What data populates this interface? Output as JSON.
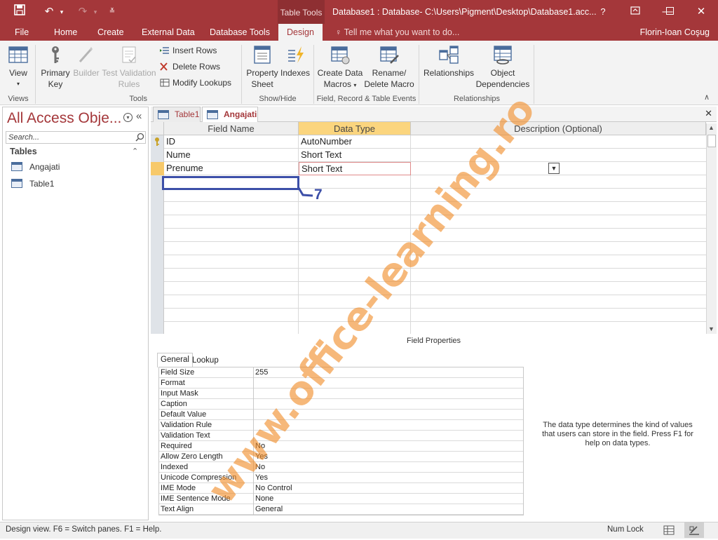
{
  "title_bar": {
    "context_tab": "Table Tools",
    "window_title": "Database1 : Database- C:\\Users\\Pigment\\Desktop\\Database1.acc...",
    "help": "?"
  },
  "menu": {
    "tabs": [
      "File",
      "Home",
      "Create",
      "External Data",
      "Database Tools",
      "Design"
    ],
    "active_tab": "Design",
    "tell_me": "Tell me what you want to do...",
    "user": "Florin-Ioan Coşug"
  },
  "ribbon": {
    "view": "View",
    "primary_key": [
      "Primary",
      "Key"
    ],
    "builder": "Builder",
    "test_validation": [
      "Test Validation",
      "Rules"
    ],
    "insert_rows": "Insert Rows",
    "delete_rows": "Delete Rows",
    "modify_lookups": "Modify Lookups",
    "property_sheet": [
      "Property",
      "Sheet"
    ],
    "indexes": "Indexes",
    "create_data_macros": [
      "Create Data",
      "Macros"
    ],
    "rename_delete_macro": [
      "Rename/",
      "Delete Macro"
    ],
    "relationships": "Relationships",
    "object_dependencies": [
      "Object",
      "Dependencies"
    ],
    "groups": [
      "Views",
      "Tools",
      "Show/Hide",
      "Field, Record & Table Events",
      "Relationships"
    ]
  },
  "nav_pane": {
    "title": "All Access Obje...",
    "search_placeholder": "Search...",
    "section": "Tables",
    "items": [
      "Angajati",
      "Table1"
    ]
  },
  "doc_tabs": [
    "Table1",
    "Angajati"
  ],
  "active_doc_tab": "Angajati",
  "design_grid": {
    "headers": [
      "Field Name",
      "Data Type",
      "Description (Optional)"
    ],
    "rows": [
      {
        "field": "ID",
        "type": "AutoNumber",
        "primary_key": true
      },
      {
        "field": "Nume",
        "type": "Short Text"
      },
      {
        "field": "Prenume",
        "type": "Short Text"
      }
    ]
  },
  "field_properties": {
    "label": "Field Properties",
    "tabs": [
      "General",
      "Lookup"
    ],
    "active_tab": "General",
    "rows": [
      {
        "name": "Field Size",
        "value": "255"
      },
      {
        "name": "Format",
        "value": ""
      },
      {
        "name": "Input Mask",
        "value": ""
      },
      {
        "name": "Caption",
        "value": ""
      },
      {
        "name": "Default Value",
        "value": ""
      },
      {
        "name": "Validation Rule",
        "value": ""
      },
      {
        "name": "Validation Text",
        "value": ""
      },
      {
        "name": "Required",
        "value": "No"
      },
      {
        "name": "Allow Zero Length",
        "value": "Yes"
      },
      {
        "name": "Indexed",
        "value": "No"
      },
      {
        "name": "Unicode Compression",
        "value": "Yes"
      },
      {
        "name": "IME Mode",
        "value": "No Control"
      },
      {
        "name": "IME Sentence Mode",
        "value": "None"
      },
      {
        "name": "Text Align",
        "value": "General"
      }
    ],
    "help": "The data type determines the kind of values that users can store in the field. Press F1 for help on data types."
  },
  "status_bar": {
    "left": "Design view.  F6 = Switch panes.  F1 = Help.",
    "num_lock": "Num Lock"
  },
  "annotation": {
    "step": "7"
  },
  "watermark": "www.office-learning.ro",
  "colors": {
    "accent": "#a4373a",
    "selected_header": "#fbd57e",
    "annotation": "#3c4fa8"
  }
}
